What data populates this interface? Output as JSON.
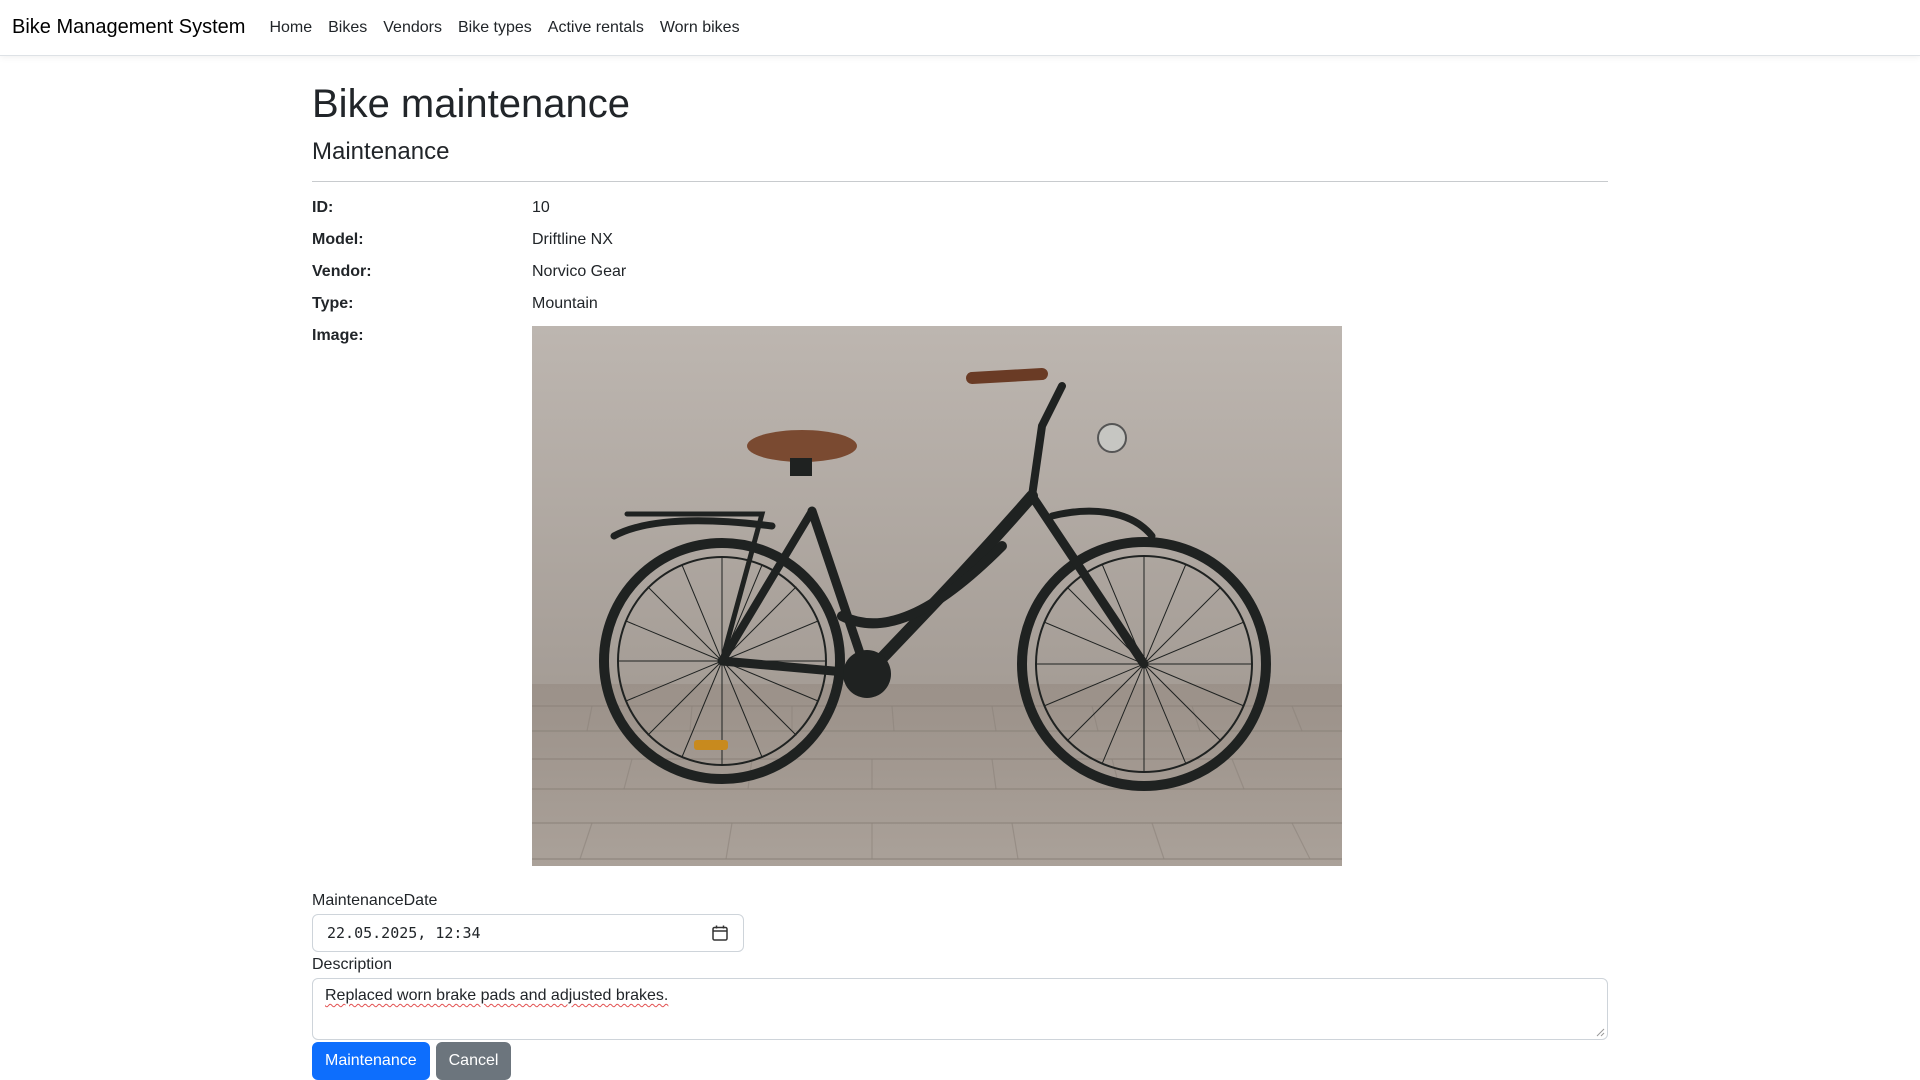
{
  "navbar": {
    "brand": "Bike Management System",
    "links": [
      "Home",
      "Bikes",
      "Vendors",
      "Bike types",
      "Active rentals",
      "Worn bikes"
    ]
  },
  "page": {
    "title": "Bike maintenance",
    "subtitle": "Maintenance"
  },
  "details": {
    "id_label": "ID:",
    "id_value": "10",
    "model_label": "Model:",
    "model_value": "Driftline NX",
    "vendor_label": "Vendor:",
    "vendor_value": "Norvico Gear",
    "type_label": "Type:",
    "type_value": "Mountain",
    "image_label": "Image:"
  },
  "form": {
    "date_label": "MaintenanceDate",
    "date_value": "22.05.2025, 12:34",
    "description_label": "Description",
    "description_value": "Replaced worn brake pads and adjusted brakes.",
    "submit_label": "Maintenance",
    "cancel_label": "Cancel"
  },
  "colors": {
    "primary": "#0d6efd",
    "secondary": "#6c757d"
  }
}
